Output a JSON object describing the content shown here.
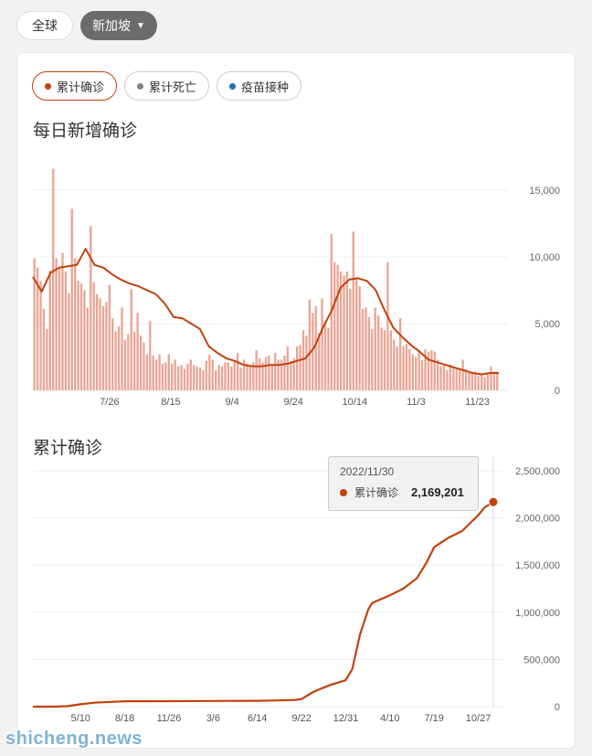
{
  "top_tabs": [
    {
      "label": "全球"
    },
    {
      "label": "新加坡"
    }
  ],
  "metric_tabs": [
    {
      "label": "累计确诊",
      "color": "#c2410c"
    },
    {
      "label": "累计死亡",
      "color": "#808080"
    },
    {
      "label": "疫苗接种",
      "color": "#1f6fb5"
    }
  ],
  "tooltip": {
    "date": "2022/11/30",
    "label": "累计确诊",
    "value": "2,169,201"
  },
  "watermark": "shicheng.news",
  "chart_data": [
    {
      "type": "bar",
      "title": "每日新增确诊",
      "bar_color": "#e8a594",
      "line_color": "#c2410c",
      "ylim": [
        0,
        15000
      ],
      "yticks": [
        "0",
        "5,000",
        "10,000",
        "15,000"
      ],
      "xticks": [
        "7/26",
        "8/15",
        "9/4",
        "9/24",
        "10/14",
        "11/3",
        "11/23"
      ],
      "x_start": "2022-07-01",
      "x_end": "2022-11-30",
      "values": [
        9900,
        9200,
        8200,
        6100,
        4600,
        9000,
        16600,
        9900,
        9100,
        10300,
        8900,
        7300,
        13600,
        9900,
        8200,
        8000,
        7500,
        6200,
        12300,
        8100,
        7200,
        6900,
        6300,
        6600,
        7900,
        5400,
        4400,
        4800,
        6200,
        3800,
        4200,
        7600,
        4400,
        5800,
        4100,
        3600,
        2700,
        5200,
        2600,
        2300,
        2700,
        2000,
        2100,
        2700,
        2000,
        2300,
        1800,
        1900,
        1600,
        2000,
        2300,
        1900,
        1800,
        1700,
        1500,
        2200,
        2700,
        2300,
        1500,
        1900,
        1800,
        2100,
        2100,
        1800,
        2200,
        2800,
        1700,
        2300,
        2000,
        1800,
        2100,
        3000,
        2400,
        2100,
        2500,
        2600,
        1900,
        2800,
        2300,
        2300,
        2600,
        3300,
        2200,
        2400,
        3300,
        3400,
        4500,
        4100,
        6800,
        5800,
        6300,
        4300,
        6900,
        4900,
        4700,
        11700,
        9600,
        9400,
        8900,
        8600,
        8900,
        7600,
        11900,
        8300,
        7800,
        6100,
        6200,
        5500,
        4600,
        6200,
        5600,
        4700,
        4500,
        9600,
        4500,
        3800,
        3300,
        5400,
        3300,
        3500,
        3100,
        2700,
        2500,
        2900,
        2300,
        3100,
        2900,
        3000,
        2900,
        2300,
        1800,
        2000,
        1500,
        1900,
        1700,
        1600,
        1600,
        2300,
        1600,
        1300,
        1300,
        1400,
        1100,
        1200,
        1000,
        1200,
        1800,
        1400,
        1300
      ],
      "trend": [
        8500,
        7400,
        8800,
        9200,
        9300,
        9400,
        10600,
        9400,
        9200,
        8700,
        8300,
        8000,
        7800,
        7500,
        7200,
        6500,
        5500,
        5400,
        5000,
        4600,
        3300,
        2800,
        2400,
        2200,
        1900,
        1800,
        1800,
        1900,
        1900,
        2000,
        2200,
        2400,
        3200,
        4700,
        6000,
        7700,
        8300,
        8400,
        8200,
        7500,
        6000,
        4700,
        4000,
        3400,
        2900,
        2300,
        2100,
        1900,
        1700,
        1500,
        1300,
        1200,
        1300,
        1300
      ],
      "series": [
        {
          "name": "累计确诊"
        }
      ]
    },
    {
      "type": "line",
      "title": "累计确诊",
      "line_color": "#c2410c",
      "ylim": [
        0,
        2500000
      ],
      "yticks": [
        "0",
        "500,000",
        "1,000,000",
        "1,500,000",
        "2,000,000",
        "2,500,000"
      ],
      "xticks": [
        "5/10",
        "8/18",
        "11/26",
        "3/6",
        "6/14",
        "9/22",
        "12/31",
        "4/10",
        "7/19",
        "10/27"
      ],
      "x": [
        "2020-01-23",
        "2020-03-10",
        "2020-04-10",
        "2020-05-10",
        "2020-06-10",
        "2020-08-18",
        "2020-11-26",
        "2021-03-06",
        "2021-06-14",
        "2021-08-01",
        "2021-09-10",
        "2021-09-22",
        "2021-10-20",
        "2021-11-26",
        "2021-12-31",
        "2022-01-15",
        "2022-02-01",
        "2022-02-20",
        "2022-03-01",
        "2022-04-10",
        "2022-05-10",
        "2022-06-10",
        "2022-07-01",
        "2022-07-19",
        "2022-08-20",
        "2022-09-20",
        "2022-10-27",
        "2022-11-10",
        "2022-11-30"
      ],
      "y": [
        0,
        200,
        5000,
        25000,
        42000,
        57000,
        58000,
        60000,
        62000,
        66000,
        72000,
        80000,
        160000,
        230000,
        280000,
        400000,
        760000,
        1030000,
        1100000,
        1180000,
        1250000,
        1360000,
        1520000,
        1690000,
        1790000,
        1860000,
        2030000,
        2110000,
        2169201
      ],
      "series": [
        {
          "name": "累计确诊"
        }
      ]
    }
  ]
}
